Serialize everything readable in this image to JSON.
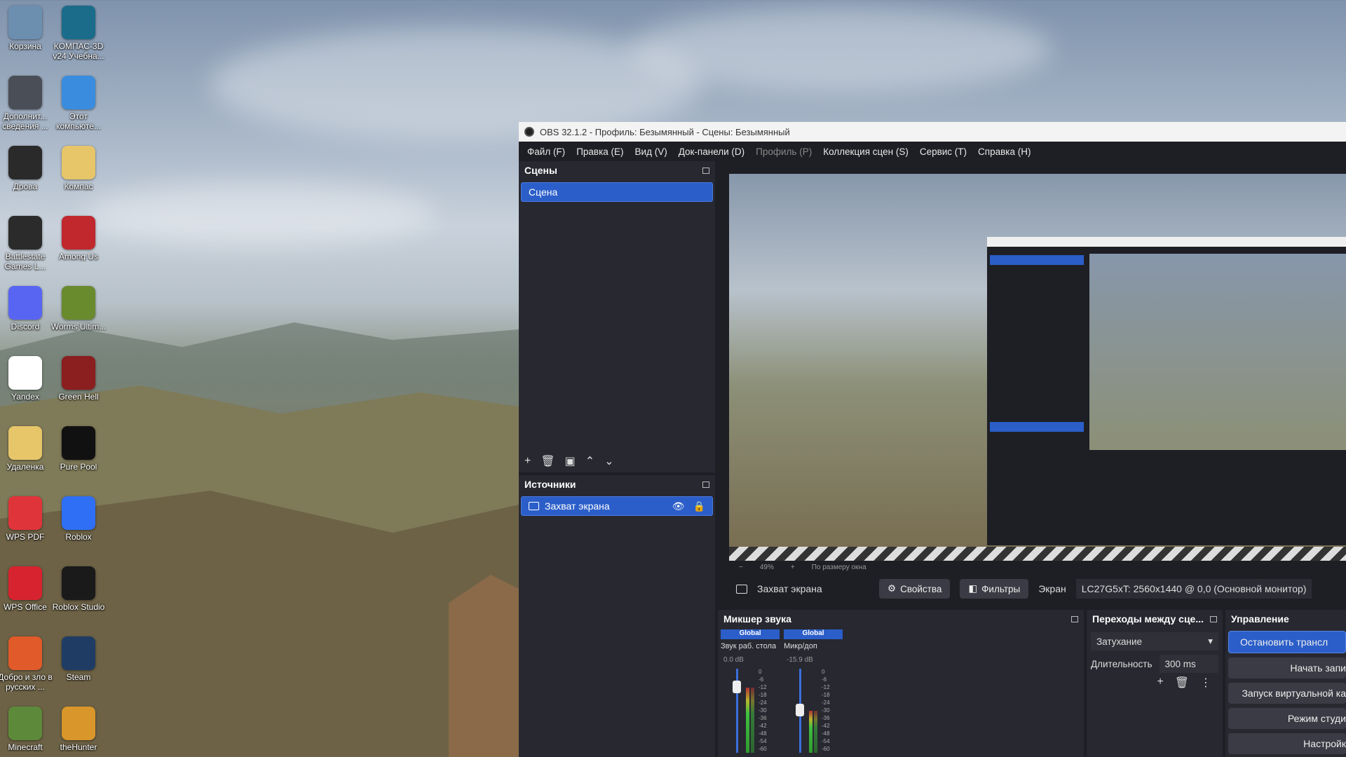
{
  "desktop": {
    "icons": [
      {
        "label": "Корзина",
        "icon": "recycle-bin-icon",
        "color": "#6c8fb0"
      },
      {
        "label": "КОМПАС-3D v24 Учебна...",
        "icon": "kompas-icon",
        "color": "#1b6c8a"
      },
      {
        "label": "Дополнит... сведения ...",
        "icon": "info-icon",
        "color": "#4a4f57"
      },
      {
        "label": "Этот компьюте...",
        "icon": "computer-icon",
        "color": "#3a8dde"
      },
      {
        "label": "Дрова",
        "icon": "nvidia-icon",
        "color": "#2a2a2a"
      },
      {
        "label": "Компас",
        "icon": "folder-icon",
        "color": "#e7c66a"
      },
      {
        "label": "Battlestate Games L...",
        "icon": "battlestate-icon",
        "color": "#2b2b2b"
      },
      {
        "label": "Among Us",
        "icon": "among-us-icon",
        "color": "#c0282d"
      },
      {
        "label": "Discord",
        "icon": "discord-icon",
        "color": "#5865f2"
      },
      {
        "label": "Worms Ultim...",
        "icon": "worms-icon",
        "color": "#6a8a2e"
      },
      {
        "label": "Yandex",
        "icon": "yandex-icon",
        "color": "#ffffff"
      },
      {
        "label": "Green Hell",
        "icon": "green-hell-icon",
        "color": "#8b1e1e"
      },
      {
        "label": "Удаленка",
        "icon": "folder-icon",
        "color": "#e7c66a"
      },
      {
        "label": "Pure Pool",
        "icon": "pool-ball-icon",
        "color": "#111111"
      },
      {
        "label": "WPS PDF",
        "icon": "wps-pdf-icon",
        "color": "#e0343b"
      },
      {
        "label": "Roblox",
        "icon": "roblox-icon",
        "color": "#2f6ff5"
      },
      {
        "label": "WPS Office",
        "icon": "wps-office-icon",
        "color": "#d7232f"
      },
      {
        "label": "Roblox Studio",
        "icon": "roblox-studio-icon",
        "color": "#1a1a1a"
      },
      {
        "label": "Добро и зло в русских ...",
        "icon": "powerpoint-icon",
        "color": "#e05a2a"
      },
      {
        "label": "Steam",
        "icon": "steam-icon",
        "color": "#1f3c64"
      },
      {
        "label": "Minecraft",
        "icon": "minecraft-icon",
        "color": "#5d8a3a"
      },
      {
        "label": "theHunter",
        "icon": "thehunter-icon",
        "color": "#d9962a"
      }
    ]
  },
  "obs": {
    "title": "OBS 32.1.2 - Профиль: Безымянный - Сцены: Безымянный",
    "menu": [
      "Файл (F)",
      "Правка (E)",
      "Вид (V)",
      "Док-панели (D)",
      "Профиль (P)",
      "Коллекция сцен (S)",
      "Сервис (T)",
      "Справка (H)"
    ],
    "scenes": {
      "title": "Сцены",
      "items": [
        "Сцена"
      ]
    },
    "sources": {
      "title": "Источники",
      "items": [
        "Захват экрана"
      ]
    },
    "source_bar": {
      "name": "Захват экрана",
      "properties": "Свойства",
      "filters": "Фильтры",
      "screen_label": "Экран",
      "screen_value": "LC27G5xT: 2560x1440 @ 0,0 (Основной монитор)"
    },
    "mixer": {
      "title": "Микшер звука",
      "channels": [
        {
          "tag": "Global",
          "name": "Звук раб. стола",
          "db": "0.0 dB",
          "level": 0.85
        },
        {
          "tag": "Global",
          "name": "Микр/доп",
          "db": "-15.9 dB",
          "level": 0.55
        }
      ],
      "scale": [
        "0",
        "-6",
        "-12",
        "-18",
        "-24",
        "-30",
        "-36",
        "-42",
        "-48",
        "-54",
        "-60"
      ]
    },
    "transitions": {
      "title": "Переходы между сце...",
      "selected": "Затухание",
      "duration_label": "Длительность",
      "duration_value": "300 ms"
    },
    "controls": {
      "title": "Управление",
      "buttons": [
        "Остановить трансл",
        "Начать запи",
        "Запуск виртуальной ка",
        "Режим студи",
        "Настройк"
      ]
    },
    "preview_zoom": {
      "zoom": "49%",
      "fit": "По размеру окна"
    }
  }
}
